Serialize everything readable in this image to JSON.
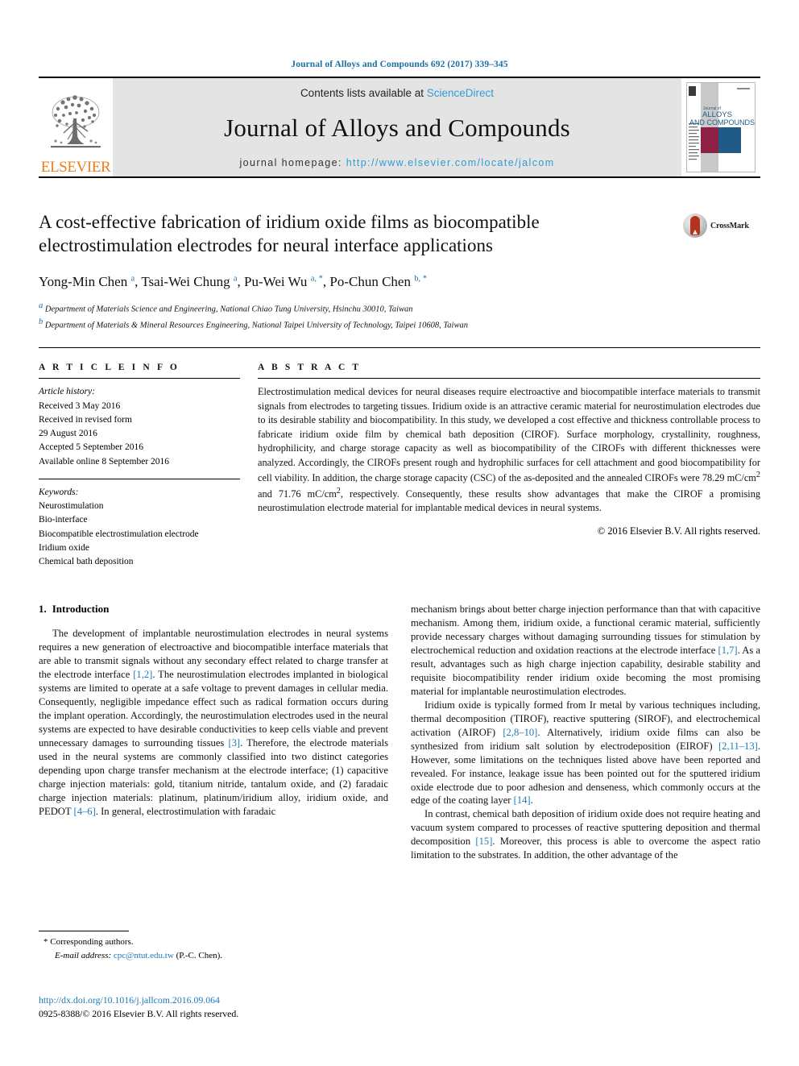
{
  "running_head": "Journal of Alloys and Compounds 692 (2017) 339–345",
  "masthead": {
    "publisher": "ELSEVIER",
    "contents_prefix": "Contents lists available at ",
    "contents_link": "ScienceDirect",
    "journal_name": "Journal of Alloys and Compounds",
    "homepage_label": "journal homepage: ",
    "homepage_url": "http://www.elsevier.com/locate/jalcom",
    "cover": {
      "line1": "Journal of",
      "line2": "ALLOYS",
      "line3": "AND COMPOUNDS",
      "color_maroon": "#8e2044",
      "color_blue": "#1f5b85",
      "color_gray": "#c9c9c9"
    },
    "colors": {
      "elsevier_orange": "#ef7d1a",
      "link_blue": "#2e9bd6",
      "band_gray": "#e4e4e4"
    }
  },
  "article": {
    "title": "A cost-effective fabrication of iridium oxide films as biocompatible electrostimulation electrodes for neural interface applications",
    "authors_html": "Yong-Min Chen <sup>a</sup>, Tsai-Wei Chung <sup>a</sup>, Pu-Wei Wu <sup>a, *</sup>, Po-Chun Chen <sup>b, *</sup>",
    "affiliations": [
      "Department of Materials Science and Engineering, National Chiao Tung University, Hsinchu 30010, Taiwan",
      "Department of Materials & Mineral Resources Engineering, National Taipei University of Technology, Taipei 10608, Taiwan"
    ],
    "affiliation_marks": [
      "a",
      "b"
    ],
    "crossmark_label": "CrossMark"
  },
  "article_info": {
    "heading": "A R T I C L E    I N F O",
    "history_title": "Article history:",
    "history": [
      "Received 3 May 2016",
      "Received in revised form",
      "29 August 2016",
      "Accepted 5 September 2016",
      "Available online 8 September 2016"
    ],
    "keywords_title": "Keywords:",
    "keywords": [
      "Neurostimulation",
      "Bio-interface",
      "Biocompatible electrostimulation electrode",
      "Iridium oxide",
      "Chemical bath deposition"
    ]
  },
  "abstract": {
    "heading": "A B S T R A C T",
    "text": "Electrostimulation medical devices for neural diseases require electroactive and biocompatible interface materials to transmit signals from electrodes to targeting tissues. Iridium oxide is an attractive ceramic material for neurostimulation electrodes due to its desirable stability and biocompatibility. In this study, we developed a cost effective and thickness controllable process to fabricate iridium oxide film by chemical bath deposition (CIROF). Surface morphology, crystallinity, roughness, hydrophilicity, and charge storage capacity as well as biocompatibility of the CIROFs with different thicknesses were analyzed. Accordingly, the CIROFs present rough and hydrophilic surfaces for cell attachment and good biocompatibility for cell viability. In addition, the charge storage capacity (CSC) of the as-deposited and the annealed CIROFs were 78.29 mC/cm² and 71.76 mC/cm², respectively. Consequently, these results show advantages that make the CIROF a promising neurostimulation electrode material for implantable medical devices in neural systems.",
    "copyright": "© 2016 Elsevier B.V. All rights reserved."
  },
  "body": {
    "section_number": "1.",
    "section_title": "Introduction",
    "left_paragraphs": [
      "The development of implantable neurostimulation electrodes in neural systems requires a new generation of electroactive and biocompatible interface materials that are able to transmit signals without any secondary effect related to charge transfer at the electrode interface [1,2]. The neurostimulation electrodes implanted in biological systems are limited to operate at a safe voltage to prevent damages in cellular media. Consequently, negligible impedance effect such as radical formation occurs during the implant operation. Accordingly, the neurostimulation electrodes used in the neural systems are expected to have desirable conductivities to keep cells viable and prevent unnecessary damages to surrounding tissues [3]. Therefore, the electrode materials used in the neural systems are commonly classified into two distinct categories depending upon charge transfer mechanism at the electrode interface; (1) capacitive charge injection materials: gold, titanium nitride, tantalum oxide, and (2) faradaic charge injection materials: platinum, platinum/iridium alloy, iridium oxide, and PEDOT [4–6]. In general, electrostimulation with faradaic"
    ],
    "right_paragraphs": [
      "mechanism brings about better charge injection performance than that with capacitive mechanism. Among them, iridium oxide, a functional ceramic material, sufficiently provide necessary charges without damaging surrounding tissues for stimulation by electrochemical reduction and oxidation reactions at the electrode interface [1,7]. As a result, advantages such as high charge injection capability, desirable stability and requisite biocompatibility render iridium oxide becoming the most promising material for implantable neurostimulation electrodes.",
      "Iridium oxide is typically formed from Ir metal by various techniques including, thermal decomposition (TIROF), reactive sputtering (SIROF), and electrochemical activation (AIROF) [2,8–10]. Alternatively, iridium oxide films can also be synthesized from iridium salt solution by electrodeposition (EIROF) [2,11–13]. However, some limitations on the techniques listed above have been reported and revealed. For instance, leakage issue has been pointed out for the sputtered iridium oxide electrode due to poor adhesion and denseness, which commonly occurs at the edge of the coating layer [14].",
      "In contrast, chemical bath deposition of iridium oxide does not require heating and vacuum system compared to processes of reactive sputtering deposition and thermal decomposition [15]. Moreover, this process is able to overcome the aspect ratio limitation to the substrates. In addition, the other advantage of the"
    ],
    "inline_refs_left": [
      "[1,2]",
      "[3]",
      "[4–6]"
    ],
    "inline_refs_right": [
      "[1,7]",
      "[2,8–10]",
      "[2,11–13]",
      "[14]",
      "[15]"
    ]
  },
  "footer": {
    "corresponding_marker": "*",
    "corresponding_text": "Corresponding authors.",
    "email_label": "E-mail address:",
    "email": "cpc@ntut.edu.tw",
    "email_suffix": "(P.-C. Chen).",
    "doi_url": "http://dx.doi.org/10.1016/j.jallcom.2016.09.064",
    "issn_line": "0925-8388/© 2016 Elsevier B.V. All rights reserved."
  }
}
